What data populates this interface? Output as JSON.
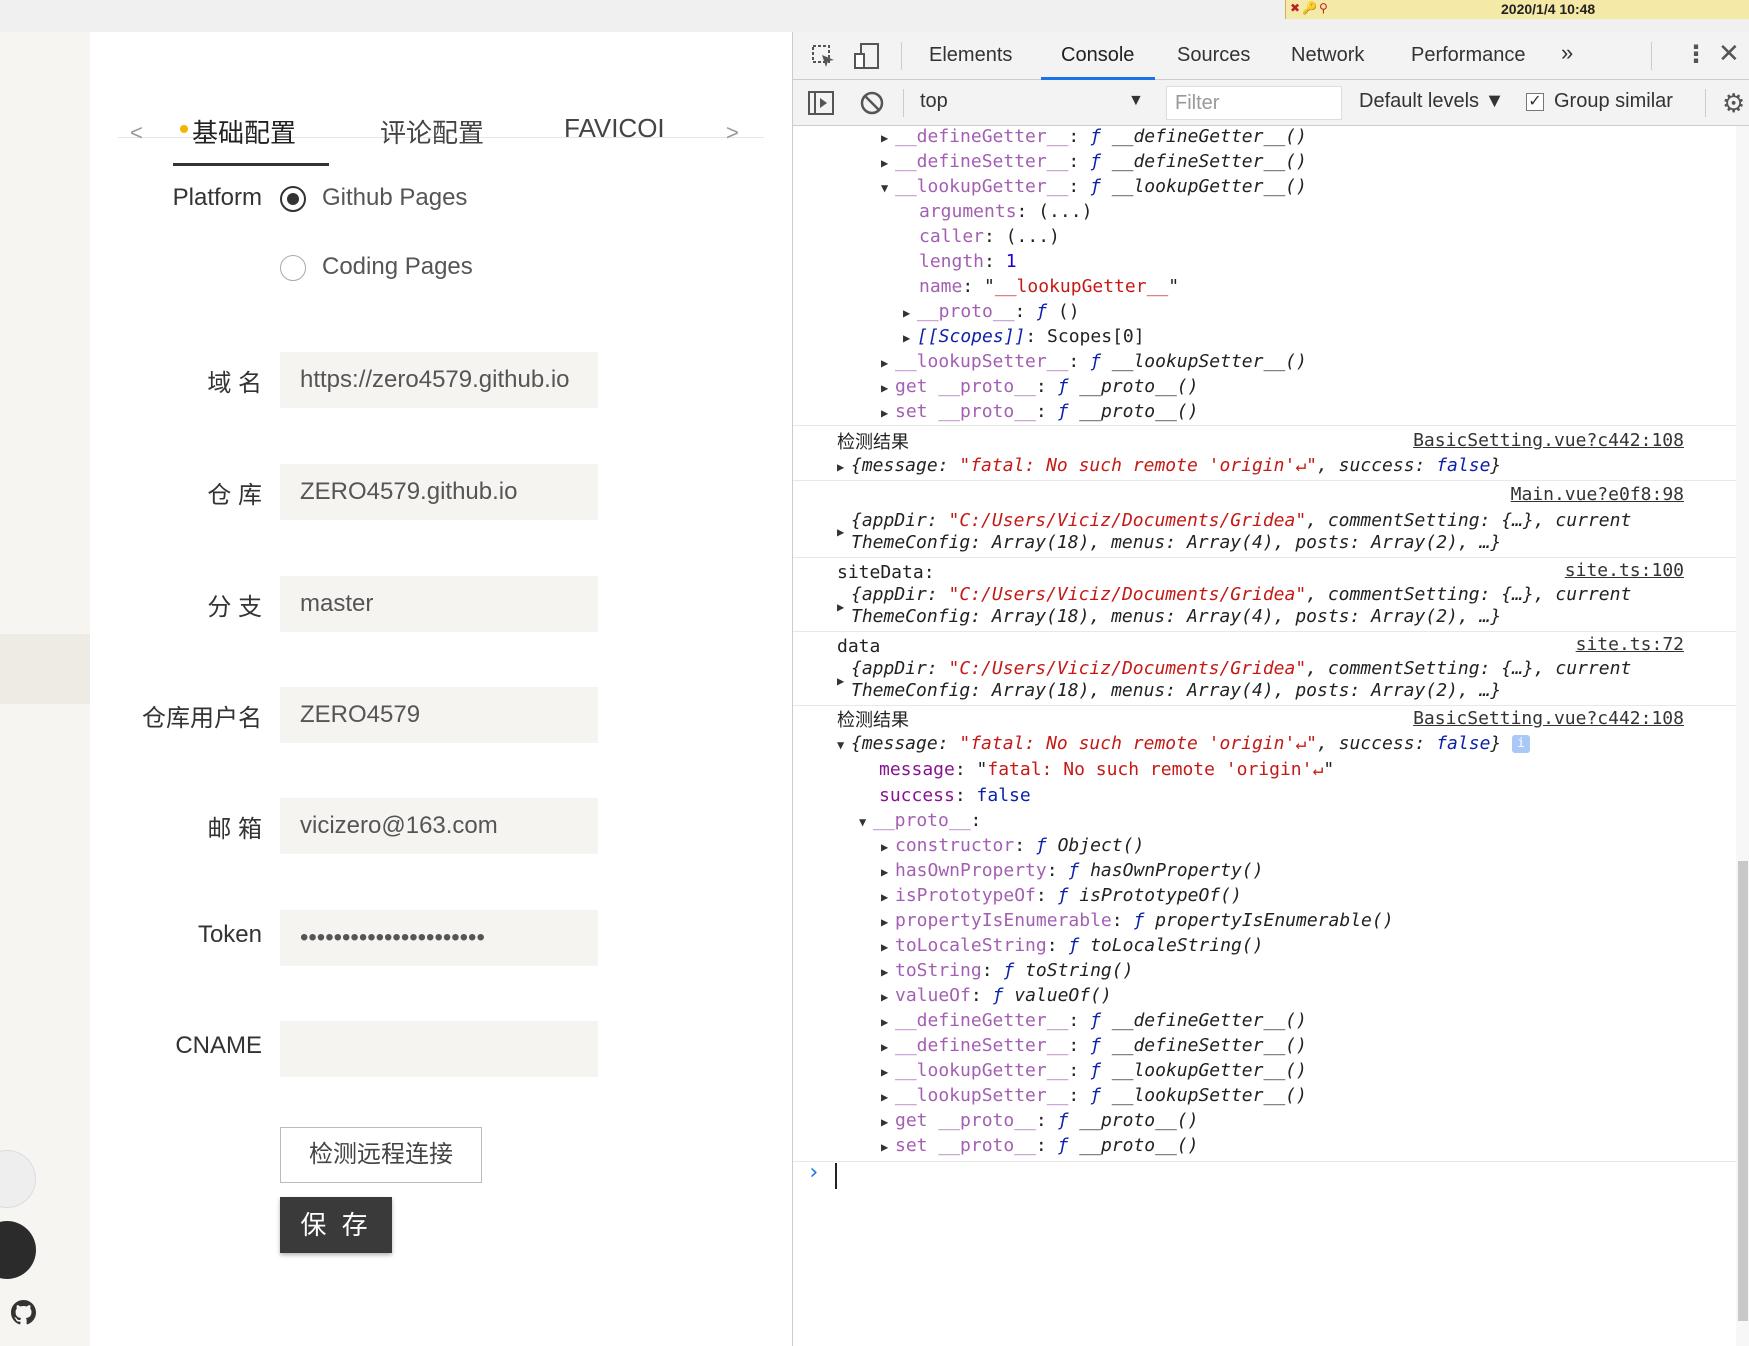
{
  "tray": {
    "clock": "2020/1/4 10:48"
  },
  "app": {
    "tabs": {
      "prev": "<",
      "next": ">",
      "tab1": "基础配置",
      "tab2": "评论配置",
      "tab3": "FAVICOI"
    },
    "platform": {
      "label": "Platform",
      "option1": "Github Pages",
      "option2": "Coding Pages"
    },
    "fields": {
      "domain": {
        "label": "域 名",
        "value": "https://zero4579.github.io"
      },
      "repo": {
        "label": "仓 库",
        "value": "ZERO4579.github.io"
      },
      "branch": {
        "label": "分 支",
        "value": "master"
      },
      "username": {
        "label": "仓库用户名",
        "value": "ZERO4579"
      },
      "email": {
        "label": "邮 箱",
        "value": "vicizero@163.com"
      },
      "token": {
        "label": "Token",
        "value": "••••••••••••••••••••••"
      },
      "cname": {
        "label": "CNAME",
        "value": ""
      }
    },
    "buttons": {
      "check": "检测远程连接",
      "save": "保 存"
    }
  },
  "devtools": {
    "tabs": {
      "elements": "Elements",
      "console": "Console",
      "sources": "Sources",
      "network": "Network",
      "performance": "Performance",
      "more": "»"
    },
    "toolbar": {
      "context": "top",
      "filter_placeholder": "Filter",
      "levels": "Default levels ▼",
      "group_similar": "Group similar"
    },
    "messages": {
      "src1": "BasicSetting.vue?c442:108",
      "src2": "Main.vue?e0f8:98",
      "src3": "site.ts:100",
      "src4": "site.ts:72",
      "src5": "BasicSetting.vue?c442:108",
      "label_check": "检测结果",
      "label_sitedata": "siteData:",
      "label_data": "data",
      "label_check2": "检测结果"
    }
  }
}
